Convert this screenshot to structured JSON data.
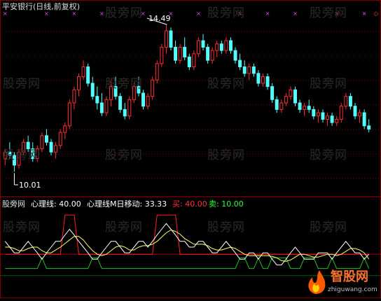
{
  "title": "平安银行(日线,前复权)",
  "watermark": "股旁网",
  "price_panel": {
    "high_label": "14.49",
    "low_label": "10.01",
    "high_value": 14.49,
    "low_value": 10.01
  },
  "indicator_panel": {
    "name": "股旁网",
    "line1": "心理线: 40.00",
    "line2": "心理线M日移动: 33.33",
    "buy": "买: 40.00",
    "sell": "卖: 10.00"
  },
  "logo": {
    "text": "智股网",
    "url": "zhiguwang.com"
  },
  "colors": {
    "bg": "#000000",
    "up": "#ff3030",
    "down": "#54ffff",
    "grid": "#7a0000",
    "white_line": "#ffffff",
    "yellow_line": "#ffff66",
    "buy_line": "#ff2020",
    "sell_line": "#20c020",
    "marker": "#ff40ff",
    "label_white": "#ffffff",
    "label_red": "#ff3030",
    "label_green": "#30ff30"
  },
  "chart_data": {
    "type": "candlestick",
    "note": "",
    "candles": [
      [
        10.4,
        10.7,
        10.2,
        10.6
      ],
      [
        10.6,
        10.9,
        10.4,
        10.5
      ],
      [
        10.5,
        10.6,
        10.0,
        10.2
      ],
      [
        10.2,
        10.7,
        10.1,
        10.6
      ],
      [
        10.6,
        11.0,
        10.5,
        10.9
      ],
      [
        10.9,
        11.1,
        10.6,
        10.7
      ],
      [
        10.7,
        10.9,
        10.3,
        10.4
      ],
      [
        10.4,
        10.8,
        10.3,
        10.7
      ],
      [
        10.7,
        11.2,
        10.6,
        11.1
      ],
      [
        11.1,
        11.3,
        10.8,
        10.9
      ],
      [
        10.9,
        11.0,
        10.5,
        10.6
      ],
      [
        10.6,
        10.9,
        10.4,
        10.8
      ],
      [
        10.8,
        11.3,
        10.7,
        11.2
      ],
      [
        11.2,
        11.5,
        11.0,
        11.4
      ],
      [
        11.4,
        12.2,
        11.3,
        12.1
      ],
      [
        12.1,
        12.6,
        11.9,
        12.5
      ],
      [
        12.5,
        13.0,
        12.3,
        12.9
      ],
      [
        12.9,
        13.4,
        12.8,
        13.2
      ],
      [
        13.2,
        13.3,
        12.6,
        12.7
      ],
      [
        12.7,
        12.9,
        12.2,
        12.3
      ],
      [
        12.3,
        12.6,
        11.9,
        12.1
      ],
      [
        12.1,
        12.4,
        11.7,
        11.8
      ],
      [
        11.8,
        12.3,
        11.7,
        12.2
      ],
      [
        12.2,
        12.8,
        12.0,
        12.6
      ],
      [
        12.6,
        12.9,
        12.2,
        12.3
      ],
      [
        12.3,
        12.4,
        11.8,
        11.9
      ],
      [
        11.9,
        12.1,
        11.6,
        11.7
      ],
      [
        11.7,
        12.3,
        11.6,
        12.2
      ],
      [
        12.2,
        12.7,
        12.1,
        12.6
      ],
      [
        12.6,
        12.9,
        12.3,
        12.4
      ],
      [
        12.4,
        12.5,
        11.9,
        12.0
      ],
      [
        12.0,
        12.4,
        11.9,
        12.3
      ],
      [
        12.3,
        12.9,
        12.2,
        12.8
      ],
      [
        12.8,
        13.4,
        12.7,
        13.3
      ],
      [
        13.3,
        13.9,
        13.2,
        13.8
      ],
      [
        13.8,
        14.49,
        13.6,
        14.3
      ],
      [
        14.3,
        14.4,
        13.7,
        13.8
      ],
      [
        13.8,
        14.0,
        13.3,
        13.4
      ],
      [
        13.4,
        13.9,
        13.3,
        13.8
      ],
      [
        13.8,
        14.1,
        13.4,
        13.5
      ],
      [
        13.5,
        13.6,
        13.1,
        13.2
      ],
      [
        13.2,
        13.7,
        13.1,
        13.6
      ],
      [
        13.6,
        14.1,
        13.5,
        14.0
      ],
      [
        14.0,
        14.2,
        13.7,
        13.8
      ],
      [
        13.8,
        13.9,
        13.3,
        13.4
      ],
      [
        13.4,
        13.8,
        13.3,
        13.7
      ],
      [
        13.7,
        14.0,
        13.5,
        13.9
      ],
      [
        13.9,
        14.0,
        13.6,
        13.7
      ],
      [
        13.7,
        14.1,
        13.6,
        14.0
      ],
      [
        14.0,
        14.1,
        13.6,
        13.7
      ],
      [
        13.7,
        13.8,
        13.3,
        13.4
      ],
      [
        13.4,
        13.6,
        13.1,
        13.2
      ],
      [
        13.2,
        13.4,
        12.9,
        13.0
      ],
      [
        13.0,
        13.3,
        12.8,
        13.2
      ],
      [
        13.2,
        13.3,
        12.9,
        13.0
      ],
      [
        13.0,
        13.1,
        12.6,
        12.7
      ],
      [
        12.7,
        13.0,
        12.6,
        12.9
      ],
      [
        12.9,
        13.0,
        12.5,
        12.6
      ],
      [
        12.6,
        12.7,
        12.1,
        12.2
      ],
      [
        12.2,
        12.3,
        11.8,
        11.9
      ],
      [
        11.9,
        12.2,
        11.8,
        12.1
      ],
      [
        12.1,
        12.4,
        12.0,
        12.3
      ],
      [
        12.3,
        12.6,
        12.2,
        12.5
      ],
      [
        12.5,
        12.6,
        12.0,
        12.1
      ],
      [
        12.1,
        12.2,
        11.8,
        11.9
      ],
      [
        11.9,
        12.1,
        11.7,
        12.0
      ],
      [
        12.0,
        12.2,
        11.8,
        11.9
      ],
      [
        11.9,
        12.0,
        11.6,
        11.7
      ],
      [
        11.7,
        11.9,
        11.5,
        11.8
      ],
      [
        11.8,
        11.9,
        11.5,
        11.6
      ],
      [
        11.6,
        11.8,
        11.4,
        11.7
      ],
      [
        11.7,
        11.8,
        11.4,
        11.5
      ],
      [
        11.5,
        11.7,
        11.4,
        11.6
      ],
      [
        11.6,
        12.1,
        11.5,
        12.0
      ],
      [
        12.0,
        12.4,
        11.9,
        12.3
      ],
      [
        12.3,
        12.4,
        11.9,
        12.0
      ],
      [
        12.0,
        12.1,
        11.6,
        11.7
      ],
      [
        11.7,
        11.9,
        11.5,
        11.8
      ],
      [
        11.8,
        11.9,
        11.3,
        11.4
      ],
      [
        11.4,
        11.6,
        11.2,
        11.3
      ]
    ],
    "psy": [
      58,
      50,
      42,
      42,
      50,
      58,
      50,
      42,
      33,
      42,
      50,
      58,
      58,
      67,
      75,
      67,
      58,
      50,
      42,
      33,
      33,
      42,
      50,
      58,
      58,
      50,
      42,
      42,
      50,
      58,
      58,
      50,
      58,
      67,
      75,
      83,
      75,
      67,
      58,
      58,
      50,
      50,
      58,
      58,
      50,
      42,
      42,
      50,
      58,
      50,
      42,
      33,
      33,
      42,
      42,
      33,
      42,
      42,
      33,
      25,
      25,
      33,
      42,
      50,
      42,
      33,
      33,
      33,
      42,
      42,
      42,
      33,
      42,
      50,
      58,
      50,
      42,
      42,
      33,
      40
    ],
    "psyma": [
      50,
      50,
      48,
      45,
      45,
      48,
      50,
      50,
      45,
      42,
      42,
      46,
      50,
      55,
      60,
      65,
      65,
      60,
      52,
      45,
      40,
      38,
      40,
      45,
      50,
      52,
      50,
      46,
      46,
      50,
      52,
      52,
      54,
      58,
      64,
      70,
      74,
      72,
      68,
      62,
      58,
      54,
      54,
      54,
      52,
      48,
      46,
      46,
      48,
      50,
      48,
      44,
      40,
      38,
      38,
      38,
      38,
      38,
      37,
      35,
      31,
      30,
      32,
      36,
      40,
      40,
      38,
      36,
      36,
      38,
      40,
      40,
      38,
      40,
      44,
      48,
      48,
      46,
      42,
      33.33
    ],
    "buy_threshold": 40,
    "sell_threshold": 10
  }
}
